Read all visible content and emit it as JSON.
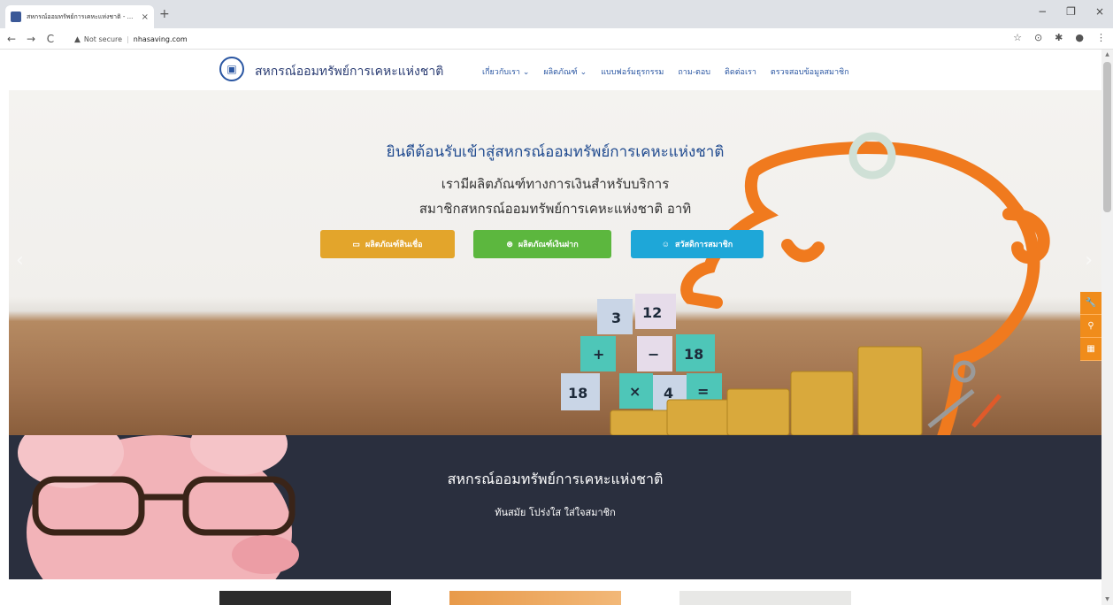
{
  "browser": {
    "tab_title": "สหกรณ์ออมทรัพย์การเคหะแห่งชาติ - ...",
    "tab_close": "×",
    "new_tab": "+",
    "security_label": "Not secure",
    "url": "nhasaving.com",
    "back": "←",
    "forward": "→",
    "reload": "C",
    "minimize": "−",
    "restore": "❐",
    "close": "×",
    "star": "☆",
    "ext1": "⊙",
    "ext2": "✱",
    "profile": "●",
    "menu": "⋮"
  },
  "site": {
    "brand": "สหกรณ์ออมทรัพย์การเคหะแห่งชาติ",
    "nav": [
      {
        "label": "เกี่ยวกับเรา ⌄"
      },
      {
        "label": "ผลิตภัณฑ์ ⌄"
      },
      {
        "label": "แบบฟอร์มธุรกรรม"
      },
      {
        "label": "ถาม-ตอบ"
      },
      {
        "label": "ติดต่อเรา"
      },
      {
        "label": "ตรวจสอบข้อมูลสมาชิก"
      }
    ]
  },
  "hero": {
    "title": "ยินดีต้อนรับเข้าสู่สหกรณ์ออมทรัพย์การเคหะแห่งชาติ",
    "subtitle_line1": "เรามีผลิตภัณฑ์ทางการเงินสำหรับบริการ",
    "subtitle_line2": "สมาชิกสหกรณ์ออมทรัพย์การเคหะแห่งชาติ อาทิ",
    "buttons": [
      {
        "label": "ผลิตภัณฑ์สินเชื่อ",
        "icon": "credit-card-icon",
        "color": "#e3a52b"
      },
      {
        "label": "ผลิตภัณฑ์เงินฝาก",
        "icon": "coin-icon",
        "color": "#5cb73e"
      },
      {
        "label": "สวัสดิการสมาชิก",
        "icon": "smile-icon",
        "color": "#1ea7d8"
      }
    ],
    "prev_arrow": "‹",
    "next_arrow": "›",
    "blocks": [
      "3",
      "12",
      "+",
      "−",
      "18",
      "18",
      "×",
      "4",
      "="
    ]
  },
  "side_widgets": [
    {
      "icon": "wrench-icon",
      "glyph": "🔧"
    },
    {
      "icon": "pin-icon",
      "glyph": "⚲"
    },
    {
      "icon": "grid-icon",
      "glyph": "▦"
    }
  ],
  "band": {
    "title": "สหกรณ์ออมทรัพย์การเคหะแห่งชาติ",
    "subtitle": "ทันสมัย โปร่งใส ใส่ใจสมาชิก"
  },
  "colors": {
    "accent_blue": "#1f4a8f",
    "orange": "#f08c1b",
    "band_bg": "#2a2f3e"
  }
}
